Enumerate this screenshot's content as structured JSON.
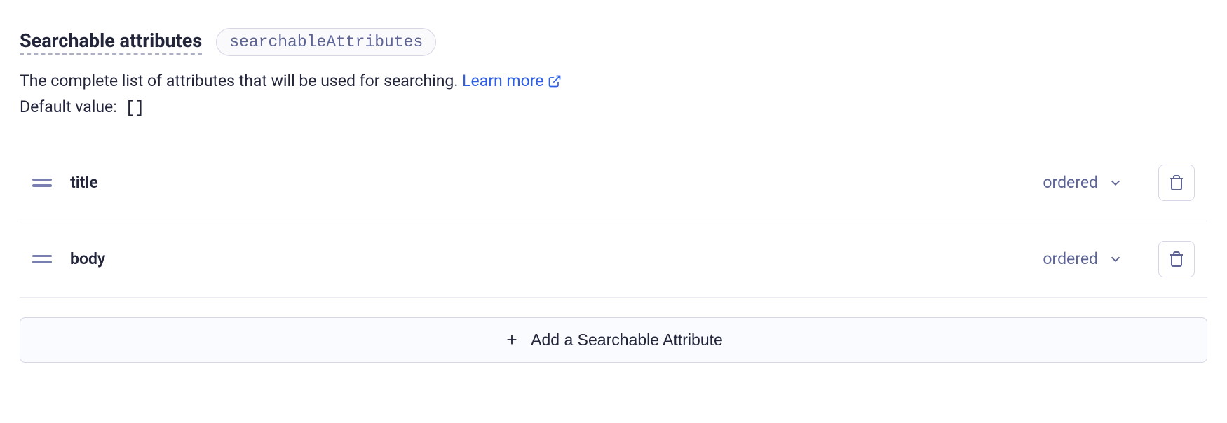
{
  "header": {
    "title": "Searchable attributes",
    "api_name": "searchableAttributes"
  },
  "description": "The complete list of attributes that will be used for searching.",
  "learn_more": "Learn more",
  "default": {
    "label": "Default value:",
    "value": "[]"
  },
  "attributes": [
    {
      "name": "title",
      "ordering": "ordered"
    },
    {
      "name": "body",
      "ordering": "ordered"
    }
  ],
  "add_button": "Add a Searchable Attribute"
}
